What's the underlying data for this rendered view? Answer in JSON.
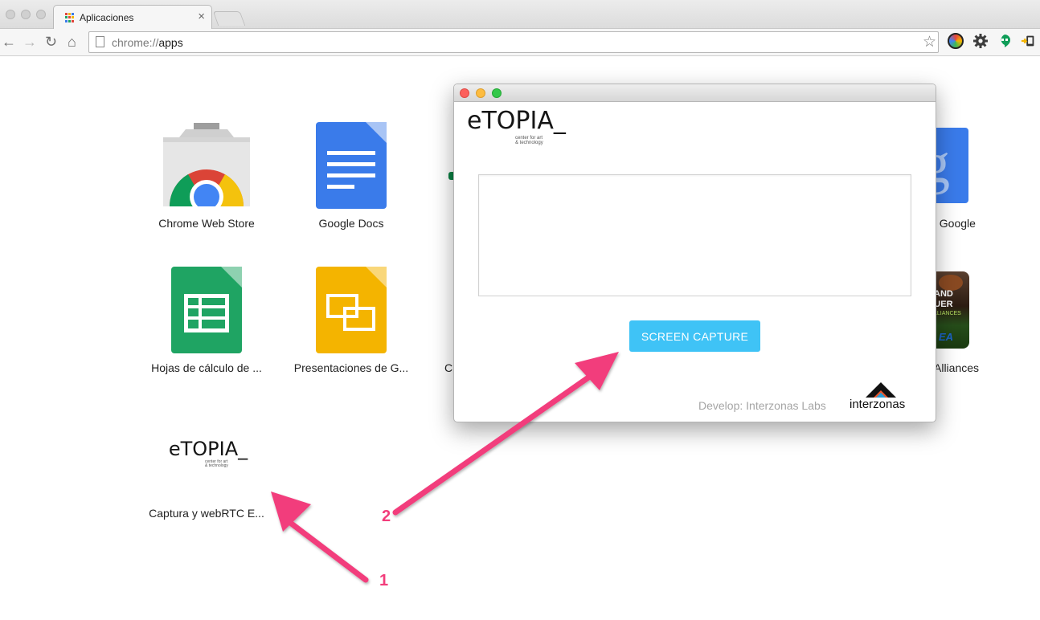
{
  "browser": {
    "tab": {
      "title": "Aplicaciones",
      "close": "×"
    },
    "url": {
      "scheme": "chrome://",
      "path": "apps"
    },
    "nav": {
      "back": "←",
      "forward": "→",
      "reload": "↻",
      "home": "⌂",
      "star": "☆"
    },
    "extensions": [
      "color-wheel-icon",
      "gear-icon",
      "hangouts-icon",
      "cast-icon"
    ]
  },
  "apps": [
    {
      "label": "Chrome Web Store",
      "icon": "chrome-web-store-icon"
    },
    {
      "label": "Google Docs",
      "icon": "docs-icon"
    },
    {
      "label": "le Google",
      "icon": "google-search-icon"
    },
    {
      "label": "Hojas de cálculo de ...",
      "icon": "sheets-icon"
    },
    {
      "label": "Presentaciones de G...",
      "icon": "slides-icon"
    },
    {
      "label": "C",
      "icon": "partial-app-icon"
    },
    {
      "label": "Alliances",
      "icon": "game-icon"
    },
    {
      "label": "Captura y webRTC E...",
      "icon": "etopia-icon"
    }
  ],
  "logo": {
    "name": "eTOPIA_",
    "tagline_1": "center for art",
    "tagline_2": "& technology"
  },
  "popup": {
    "capture_button": "SCREEN CAPTURE",
    "credit": "Develop: Interzonas Labs",
    "brand": "interzonas"
  },
  "annotations": {
    "step_1": "1",
    "step_2": "2",
    "color": "#f23d7b"
  },
  "colors": {
    "capture_button": "#3fc3f6",
    "docs": "#3a7bea",
    "sheets": "#1fa463",
    "slides": "#f4b400"
  }
}
